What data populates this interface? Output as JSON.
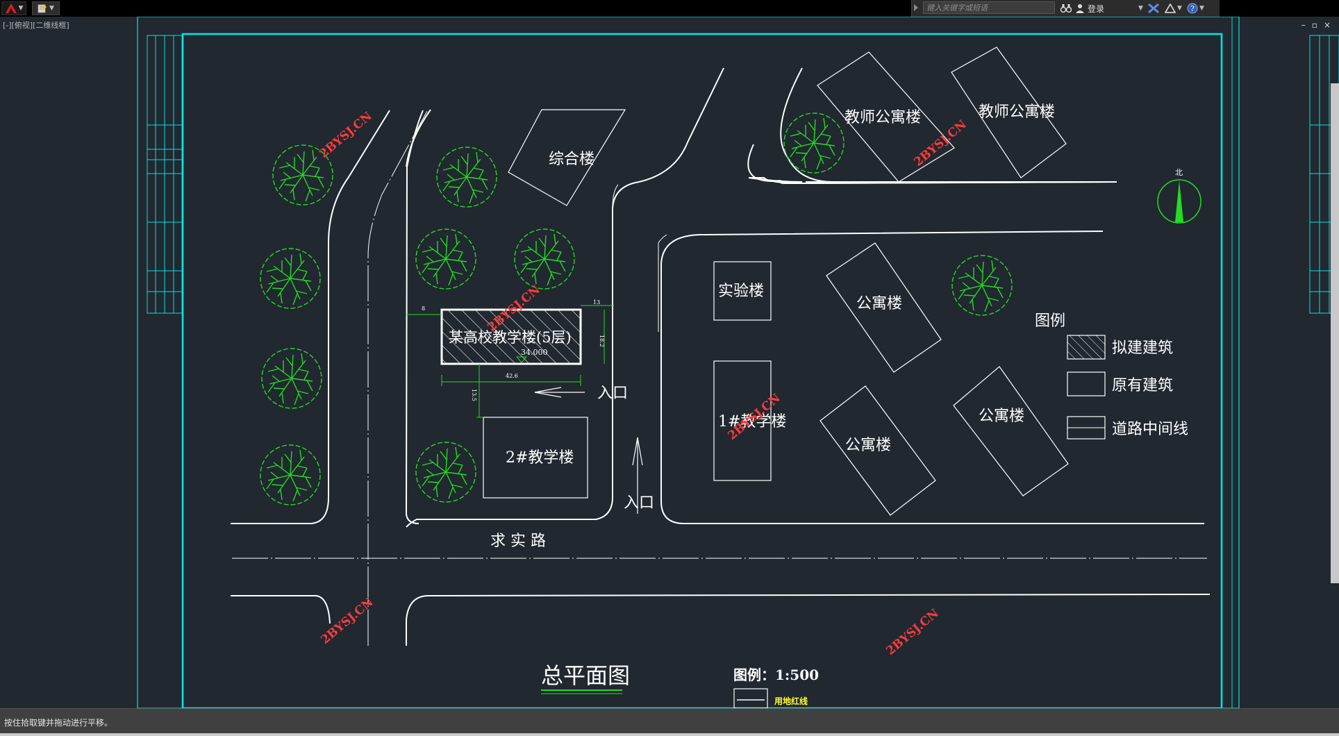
{
  "toolbar": {
    "app_icon": "autocad-logo-icon",
    "search_placeholder": "键入关键字或短语",
    "login_label": "登录"
  },
  "viewport": {
    "view_label": "[-][俯视][二维线框]",
    "window_controls": [
      "–",
      "▫",
      "×"
    ]
  },
  "drawing": {
    "title": "总平面图",
    "scale_label": "图例：1:500",
    "redline_legend": "用地红线",
    "road_name": "求 实 路",
    "north_label": "北",
    "watermark": "2BYSJ.CN",
    "buildings": {
      "zonghe": "综合楼",
      "teacher_apt_1": "教师公寓楼",
      "teacher_apt_2": "教师公寓楼",
      "lab": "实验楼",
      "apt_1": "公寓楼",
      "apt_2": "公寓楼",
      "apt_3": "公寓楼",
      "teaching_1": "1#教学楼",
      "teaching_2": "2#教学楼",
      "proposed": "某高校教学楼(5层)"
    },
    "elevation": "34.000",
    "dimensions": {
      "d_left": "8",
      "d_right": "13",
      "d_height": "18.2",
      "d_width": "42.6",
      "d_bottom": "13.5"
    },
    "entrances": [
      "入口",
      "入口"
    ],
    "legend": {
      "title": "图例",
      "proposed": "拟建建筑",
      "existing": "原有建筑",
      "road_centerline": "道路中间线"
    }
  },
  "status": {
    "message": "按住拾取键并拖动进行平移。"
  },
  "colors": {
    "canvas_bg": "#212830",
    "frame_cyan": "#00e5e5",
    "linework": "#ffffff",
    "trees_green": "#22dd22",
    "watermark_red": "#ff3b3b",
    "redline_yellow": "#ffff33"
  }
}
